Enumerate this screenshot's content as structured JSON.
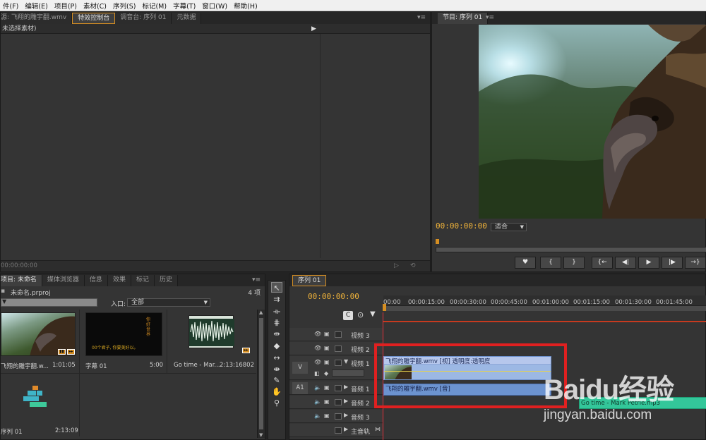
{
  "menu": [
    "件(F)",
    "编辑(E)",
    "项目(P)",
    "素材(C)",
    "序列(S)",
    "标记(M)",
    "字幕(T)",
    "窗口(W)",
    "帮助(H)"
  ],
  "source_panel": {
    "tabs": [
      "源: 飞翔的雕宇翻.wmv",
      "特效控制台",
      "调音台: 序列 01",
      "元数据"
    ],
    "active_tab": "特效控制台",
    "no_clip_text": "未选择素材)",
    "timecode": "00:00:00:00"
  },
  "program_panel": {
    "tab": "节目: 序列 01",
    "timecode": "00:00:00:00",
    "fit_select": "适合",
    "buttons": [
      "♥",
      "{",
      "}",
      "{←",
      "◀|",
      "▶",
      "|▶",
      "→}"
    ]
  },
  "project_panel": {
    "tabs": [
      "项目: 未命名",
      "媒体浏览器",
      "信息",
      "效果",
      "标记",
      "历史"
    ],
    "project_file": "未命名.prproj",
    "item_count": "4 项",
    "in_label": "入口:",
    "in_value": "全部",
    "items": [
      {
        "name": "飞翔的雕宇翻.w...",
        "duration": "1:01:05"
      },
      {
        "name": "字幕 01",
        "duration": "5:00",
        "subtitle_line1": "你好\n世界",
        "subtitle_line2": "00个君子, 你要美好以。"
      },
      {
        "name": "Go time - Mar...",
        "duration": "2:13:16802"
      },
      {
        "name": "序列 01",
        "duration": "2:13:09"
      }
    ]
  },
  "timeline": {
    "tab": "序列 01",
    "timecode": "00:00:00:00",
    "ruler_ticks": [
      "00:00",
      "00:00:15:00",
      "00:00:30:00",
      "00:00:45:00",
      "00:01:00:00",
      "00:01:15:00",
      "00:01:30:00",
      "00:01:45:00"
    ],
    "video_tracks": [
      "视频 3",
      "视频 2",
      "视频 1"
    ],
    "audio_tracks": [
      "音频 1",
      "音频 2",
      "音频 3",
      "主音轨"
    ],
    "v_label": "V",
    "a_label": "A1",
    "video_clip": "飞翔的雕宇翻.wmv [视] 透明度:透明度",
    "audio_clip": "飞翔的雕宇翻.wmv [音]",
    "music_clip": "Go time - Mark Petrie.mp3"
  },
  "watermark": {
    "line1": "Baidu经验",
    "line2": "jingyan.baidu.com"
  },
  "colors": {
    "accent": "#d58e22",
    "timecode": "#f0b33a",
    "clip": "#9cb8e4",
    "highlight": "#e02020"
  }
}
